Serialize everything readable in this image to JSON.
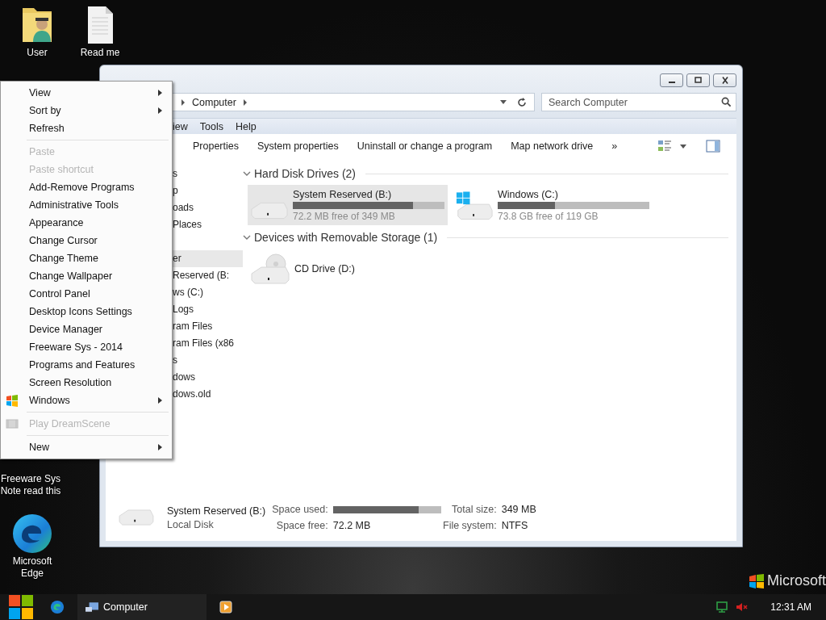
{
  "desktop": {
    "icons": [
      {
        "label": "User",
        "kind": "user-folder"
      },
      {
        "label": "Read me",
        "kind": "document"
      },
      {
        "label": "Freeware Sys Note read this",
        "kind": "hidden"
      },
      {
        "label": "Microsoft Edge",
        "kind": "edge"
      }
    ],
    "wallpaper_brand": "Microsoft"
  },
  "explorer": {
    "address": {
      "crumbs": [
        "Computer"
      ]
    },
    "search": {
      "placeholder": "Search Computer"
    },
    "menu_bar": [
      "iew",
      "Tools",
      "Help"
    ],
    "toolbar": [
      "Properties",
      "System properties",
      "Uninstall or change a program",
      "Map network drive",
      "»"
    ],
    "sidebar": {
      "favorites": [
        {
          "label": "s",
          "selected": false
        },
        {
          "label": "p",
          "selected": false
        },
        {
          "label": "oads",
          "selected": false
        },
        {
          "label": "Places",
          "selected": false
        }
      ],
      "computer": [
        {
          "label": "er",
          "selected": true
        },
        {
          "label": "Reserved (B:",
          "selected": false
        },
        {
          "label": "ws (C:)",
          "selected": false
        },
        {
          "label": "Logs",
          "selected": false
        },
        {
          "label": "ram Files",
          "selected": false
        },
        {
          "label": "ram Files (x86",
          "selected": false
        },
        {
          "label": "s",
          "selected": false
        },
        {
          "label": "dows",
          "selected": false
        },
        {
          "label": "dows.old",
          "selected": false
        }
      ]
    },
    "groups": [
      {
        "title": "Hard Disk Drives (2)",
        "expanded": true,
        "drives": [
          {
            "name": "System Reserved (B:)",
            "kind": "drive",
            "selected": true,
            "level": 0.79,
            "free": "72.2 MB free of 349 MB"
          },
          {
            "name": "Windows (C:)",
            "kind": "os-drive",
            "selected": false,
            "level": 0.38,
            "free": "73.8 GB free of 119 GB"
          }
        ]
      },
      {
        "title": "Devices with Removable Storage (1)",
        "expanded": true,
        "drives": [
          {
            "name": "CD Drive (D:)",
            "kind": "cd",
            "selected": false
          }
        ]
      }
    ],
    "details": {
      "name": "System Reserved (B:)",
      "type": "Local Disk",
      "used_label": "Space used:",
      "level": 0.79,
      "free_label": "Space free:",
      "free": "72.2 MB",
      "total_label": "Total size:",
      "total": "349 MB",
      "fs_label": "File system:",
      "fs": "NTFS"
    }
  },
  "context_menu": [
    {
      "kind": "item",
      "label": "View",
      "submenu": true,
      "disabled": false
    },
    {
      "kind": "item",
      "label": "Sort by",
      "submenu": true,
      "disabled": false
    },
    {
      "kind": "item",
      "label": "Refresh",
      "submenu": false,
      "disabled": false
    },
    {
      "kind": "separator"
    },
    {
      "kind": "item",
      "label": "Paste",
      "submenu": false,
      "disabled": true
    },
    {
      "kind": "item",
      "label": "Paste shortcut",
      "submenu": false,
      "disabled": true
    },
    {
      "kind": "item",
      "label": "Add-Remove Programs",
      "submenu": false,
      "disabled": false
    },
    {
      "kind": "item",
      "label": "Administrative Tools",
      "submenu": false,
      "disabled": false
    },
    {
      "kind": "item",
      "label": "Appearance",
      "submenu": false,
      "disabled": false
    },
    {
      "kind": "item",
      "label": "Change Cursor",
      "submenu": false,
      "disabled": false
    },
    {
      "kind": "item",
      "label": "Change Theme",
      "submenu": false,
      "disabled": false
    },
    {
      "kind": "item",
      "label": "Change Wallpaper",
      "submenu": false,
      "disabled": false
    },
    {
      "kind": "item",
      "label": "Control Panel",
      "submenu": false,
      "disabled": false
    },
    {
      "kind": "item",
      "label": "Desktop Icons Settings",
      "submenu": false,
      "disabled": false
    },
    {
      "kind": "item",
      "label": "Device Manager",
      "submenu": false,
      "disabled": false
    },
    {
      "kind": "item",
      "label": "Freeware Sys - 2014",
      "submenu": false,
      "disabled": false
    },
    {
      "kind": "item",
      "label": "Programs and Features",
      "submenu": false,
      "disabled": false
    },
    {
      "kind": "item",
      "label": "Screen Resolution",
      "submenu": false,
      "disabled": false
    },
    {
      "kind": "flag",
      "label": "Windows",
      "submenu": true,
      "disabled": false
    },
    {
      "kind": "separator"
    },
    {
      "kind": "film",
      "label": "Play DreamScene",
      "submenu": false,
      "disabled": true
    },
    {
      "kind": "separator"
    },
    {
      "kind": "item",
      "label": "New",
      "submenu": true,
      "disabled": false
    }
  ],
  "taskbar": {
    "tasks": [
      {
        "label": "Computer",
        "selected": true
      }
    ],
    "muted": true,
    "clock": "12:31 AM"
  }
}
